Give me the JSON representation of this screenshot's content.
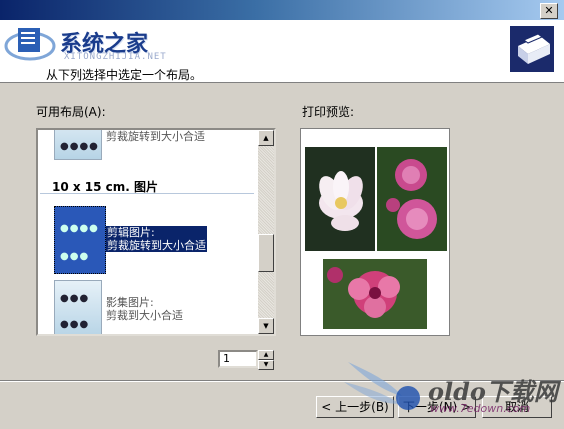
{
  "window": {
    "close_glyph": "✕"
  },
  "header": {
    "logo_text": "系统之家",
    "logo_sub": "XITONGZHIJIA.NET",
    "subtitle": "从下列选择中选定一个布局。",
    "icon": "printer-icon"
  },
  "layouts": {
    "label": "可用布局(A):",
    "items": [
      {
        "text": "剪裁旋转到大小合适"
      },
      {
        "section": "10 x 15 cm. 图片"
      },
      {
        "text_line1": "剪辑图片:",
        "text_line2": "剪裁旋转到大小合适",
        "selected": true
      },
      {
        "text_line1": "影集图片:",
        "text_line2": "剪裁到大小合适"
      }
    ],
    "scroll_up": "▲",
    "scroll_down": "▼"
  },
  "preview": {
    "label": "打印预览:",
    "colors": {
      "lotus": "#f3e6ee",
      "bg_dark": "#203020",
      "flower_pink": "#d0407a"
    }
  },
  "copies": {
    "value": "1",
    "up": "▲",
    "down": "▼"
  },
  "buttons": {
    "back": "< 上一步(B)",
    "next": "下一步(N) >",
    "cancel": "取消"
  },
  "watermark": {
    "main": "oldo下载网",
    "url": "www.7edown.com"
  }
}
